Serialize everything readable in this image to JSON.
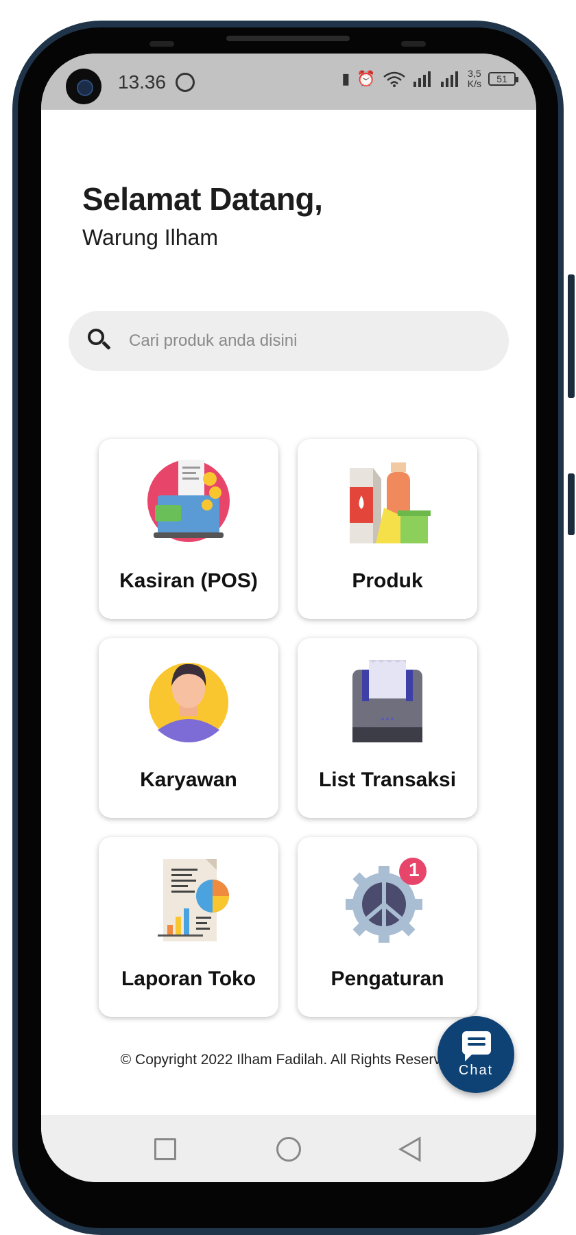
{
  "status_bar": {
    "time": "13.36",
    "speed_value": "3,5",
    "speed_unit": "K/s",
    "battery": "51"
  },
  "header": {
    "greeting": "Selamat Datang,",
    "store_name": "Warung Ilham"
  },
  "search": {
    "placeholder": "Cari produk anda disini"
  },
  "menu": [
    {
      "label": "Kasiran (POS)",
      "icon": "cashier-icon"
    },
    {
      "label": "Produk",
      "icon": "products-icon"
    },
    {
      "label": "Karyawan",
      "icon": "employee-icon"
    },
    {
      "label": "List Transaksi",
      "icon": "receipt-printer-icon"
    },
    {
      "label": "Laporan Toko",
      "icon": "report-icon"
    },
    {
      "label": "Pengaturan",
      "icon": "settings-gear-icon"
    }
  ],
  "settings_badge": "1",
  "footer": {
    "copyright": "© Copyright 2022 Ilham Fadilah. All Rights Reserved"
  },
  "chat": {
    "label": "Chat"
  },
  "colors": {
    "accent": "#0f4274",
    "status_bar_bg": "#c2c2c2",
    "search_bg": "#eeeeee"
  }
}
